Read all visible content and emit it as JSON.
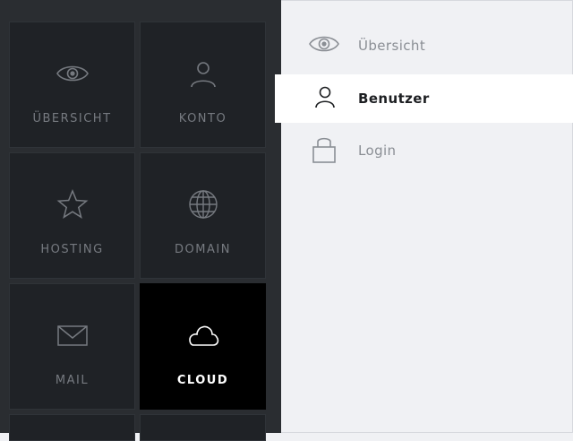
{
  "tiles": [
    {
      "label": "ÜBERSICHT",
      "icon": "eye-icon"
    },
    {
      "label": "KONTO",
      "icon": "user-icon"
    },
    {
      "label": "HOSTING",
      "icon": "star-icon"
    },
    {
      "label": "DOMAIN",
      "icon": "globe-icon"
    },
    {
      "label": "MAIL",
      "icon": "mail-icon"
    },
    {
      "label": "CLOUD",
      "icon": "cloud-icon",
      "active": true
    }
  ],
  "menu": {
    "items": [
      {
        "label": "Übersicht",
        "icon": "eye-icon"
      },
      {
        "label": "Benutzer",
        "icon": "user-icon",
        "active": true
      },
      {
        "label": "Login",
        "icon": "lock-icon"
      }
    ]
  },
  "colors": {
    "panel_bg": "#2a2d31",
    "tile_bg": "#1f2226",
    "active_tile_bg": "#000000",
    "menu_bg": "#f0f1f4",
    "active_menu_bg": "#ffffff"
  }
}
